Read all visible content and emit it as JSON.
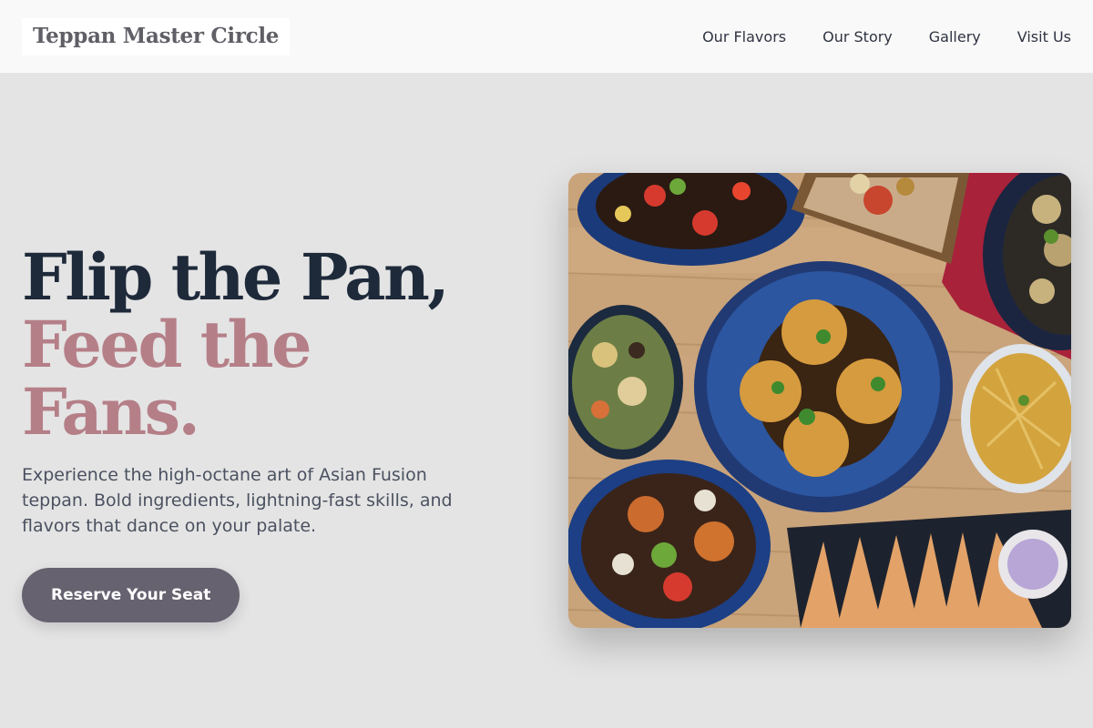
{
  "brand": {
    "name": "Teppan Master Circle"
  },
  "nav": {
    "links": [
      {
        "label": "Our Flavors"
      },
      {
        "label": "Our Story"
      },
      {
        "label": "Gallery"
      },
      {
        "label": "Visit Us"
      }
    ]
  },
  "hero": {
    "headline_line1": "Flip the Pan,",
    "headline_line2": "Feed the Fans.",
    "description": "Experience the high-octane art of Asian Fusion teppan. Bold ingredients, lightning-fast skills, and flavors that dance on your palate.",
    "cta_label": "Reserve Your Seat",
    "image_alt": "Overhead view of Asian fusion dishes on blue ceramic plates on a wooden table"
  },
  "colors": {
    "headline_dark": "#1e2a3a",
    "headline_accent": "#b57f88",
    "cta_background": "#67626f",
    "page_background": "#e4e4e4",
    "nav_background": "#f9f9f9"
  }
}
